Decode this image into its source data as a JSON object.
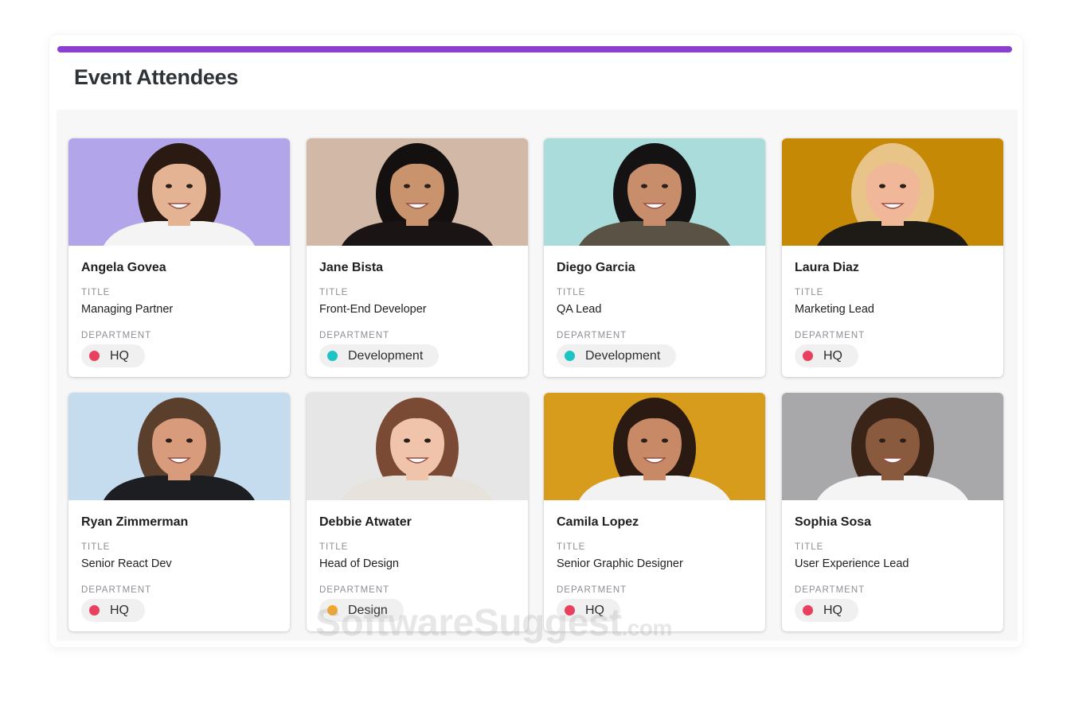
{
  "header": {
    "title": "Event Attendees",
    "accent_color": "#8a3fd1"
  },
  "labels": {
    "title": "TITLE",
    "department": "DEPARTMENT"
  },
  "department_colors": {
    "HQ": "#e8405e",
    "Development": "#1ec3c3",
    "Design": "#f5a623"
  },
  "attendees": [
    {
      "name": "Angela Govea",
      "title": "Managing Partner",
      "department": "HQ",
      "dept_color": "#e8405e",
      "photo_bg": "#b2a5ea",
      "hair": "#2a1a12",
      "skin": "#e4b394",
      "shirt": "#f4f4f4"
    },
    {
      "name": "Jane Bista",
      "title": "Front-End Developer",
      "department": "Development",
      "dept_color": "#1ec3c3",
      "photo_bg": "#d2b8a7",
      "hair": "#141010",
      "skin": "#c9936d",
      "shirt": "#1a1414"
    },
    {
      "name": "Diego Garcia",
      "title": "QA Lead",
      "department": "Development",
      "dept_color": "#1ec3c3",
      "photo_bg": "#a9dcdb",
      "hair": "#141212",
      "skin": "#c88e6c",
      "shirt": "#5a5244"
    },
    {
      "name": "Laura Diaz",
      "title": "Marketing Lead",
      "department": "HQ",
      "dept_color": "#e8405e",
      "photo_bg": "#c58905",
      "hair": "#e8c488",
      "skin": "#f0b898",
      "shirt": "#1e1a16"
    },
    {
      "name": "Ryan Zimmerman",
      "title": "Senior React Dev",
      "department": "HQ",
      "dept_color": "#e8405e",
      "photo_bg": "#c5dcef",
      "hair": "#5a3f2c",
      "skin": "#d89c7c",
      "shirt": "#1c1e22"
    },
    {
      "name": "Debbie Atwater",
      "title": "Head of Design",
      "department": "Design",
      "dept_color": "#f5a623",
      "photo_bg": "#e6e6e6",
      "hair": "#7a4a34",
      "skin": "#f0c4aa",
      "shirt": "#e8e2dc"
    },
    {
      "name": "Camila Lopez",
      "title": "Senior Graphic Designer",
      "department": "HQ",
      "dept_color": "#e8405e",
      "photo_bg": "#d89c1c",
      "hair": "#2a1a12",
      "skin": "#c88a66",
      "shirt": "#f2f2f2"
    },
    {
      "name": "Sophia Sosa",
      "title": "User Experience Lead",
      "department": "HQ",
      "dept_color": "#e8405e",
      "photo_bg": "#a8a8aa",
      "hair": "#3a2418",
      "skin": "#8a5a3e",
      "shirt": "#f4f4f4"
    }
  ],
  "watermark": {
    "main": "SoftwareSuggest",
    "suffix": ".com"
  }
}
